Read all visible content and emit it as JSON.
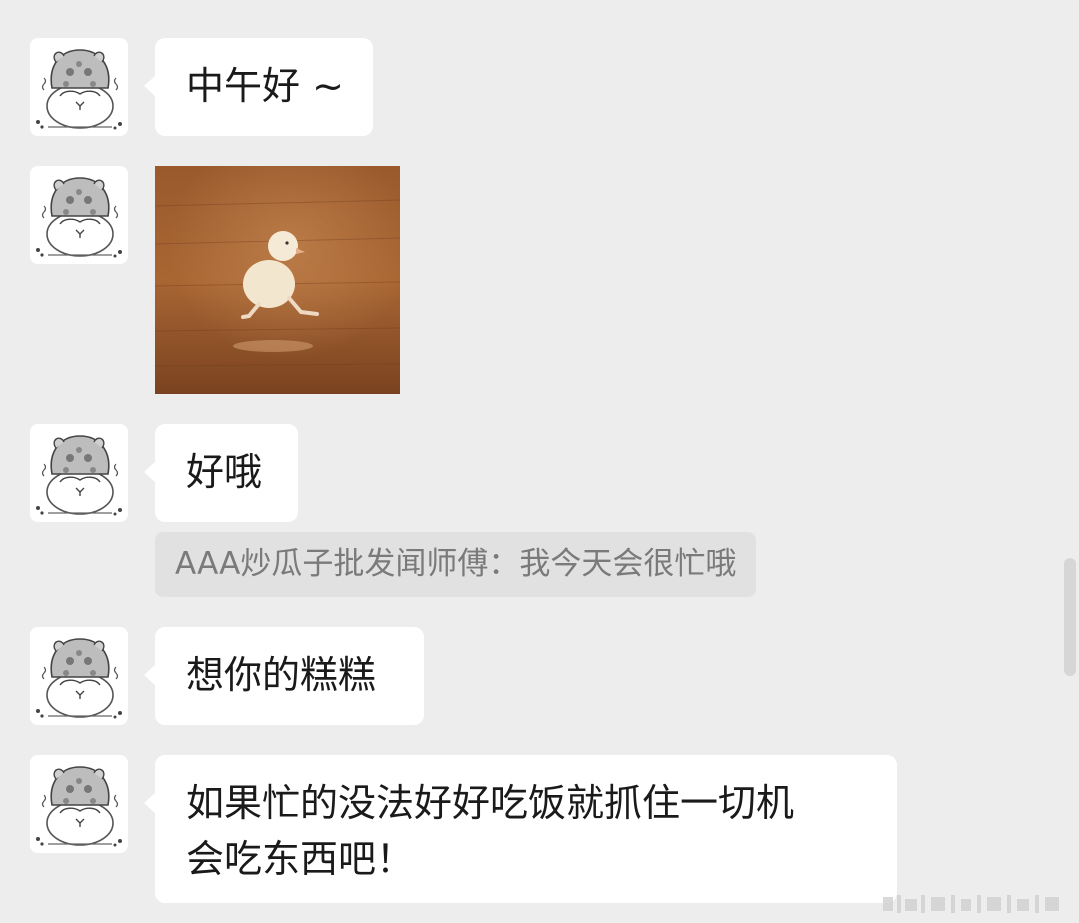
{
  "messages": [
    {
      "type": "text",
      "text": "中午好 ~"
    },
    {
      "type": "image",
      "alt": "duckling on wooden floor"
    },
    {
      "type": "text",
      "text": "好哦"
    },
    {
      "type": "quote",
      "text": "AAA炒瓜子批发闻师傅：我今天会很忙哦"
    },
    {
      "type": "text",
      "text": "想你的糕糕"
    },
    {
      "type": "text",
      "lines": [
        "如果忙的没法好好吃饭就抓住一切机",
        "会吃东西吧！"
      ]
    }
  ],
  "colors": {
    "background": "#ededed",
    "bubble": "#ffffff",
    "quote_bg": "#e1e1e1",
    "quote_text": "#7a7a7a"
  },
  "icons": {
    "avatar": "hamster-avatar-icon"
  }
}
